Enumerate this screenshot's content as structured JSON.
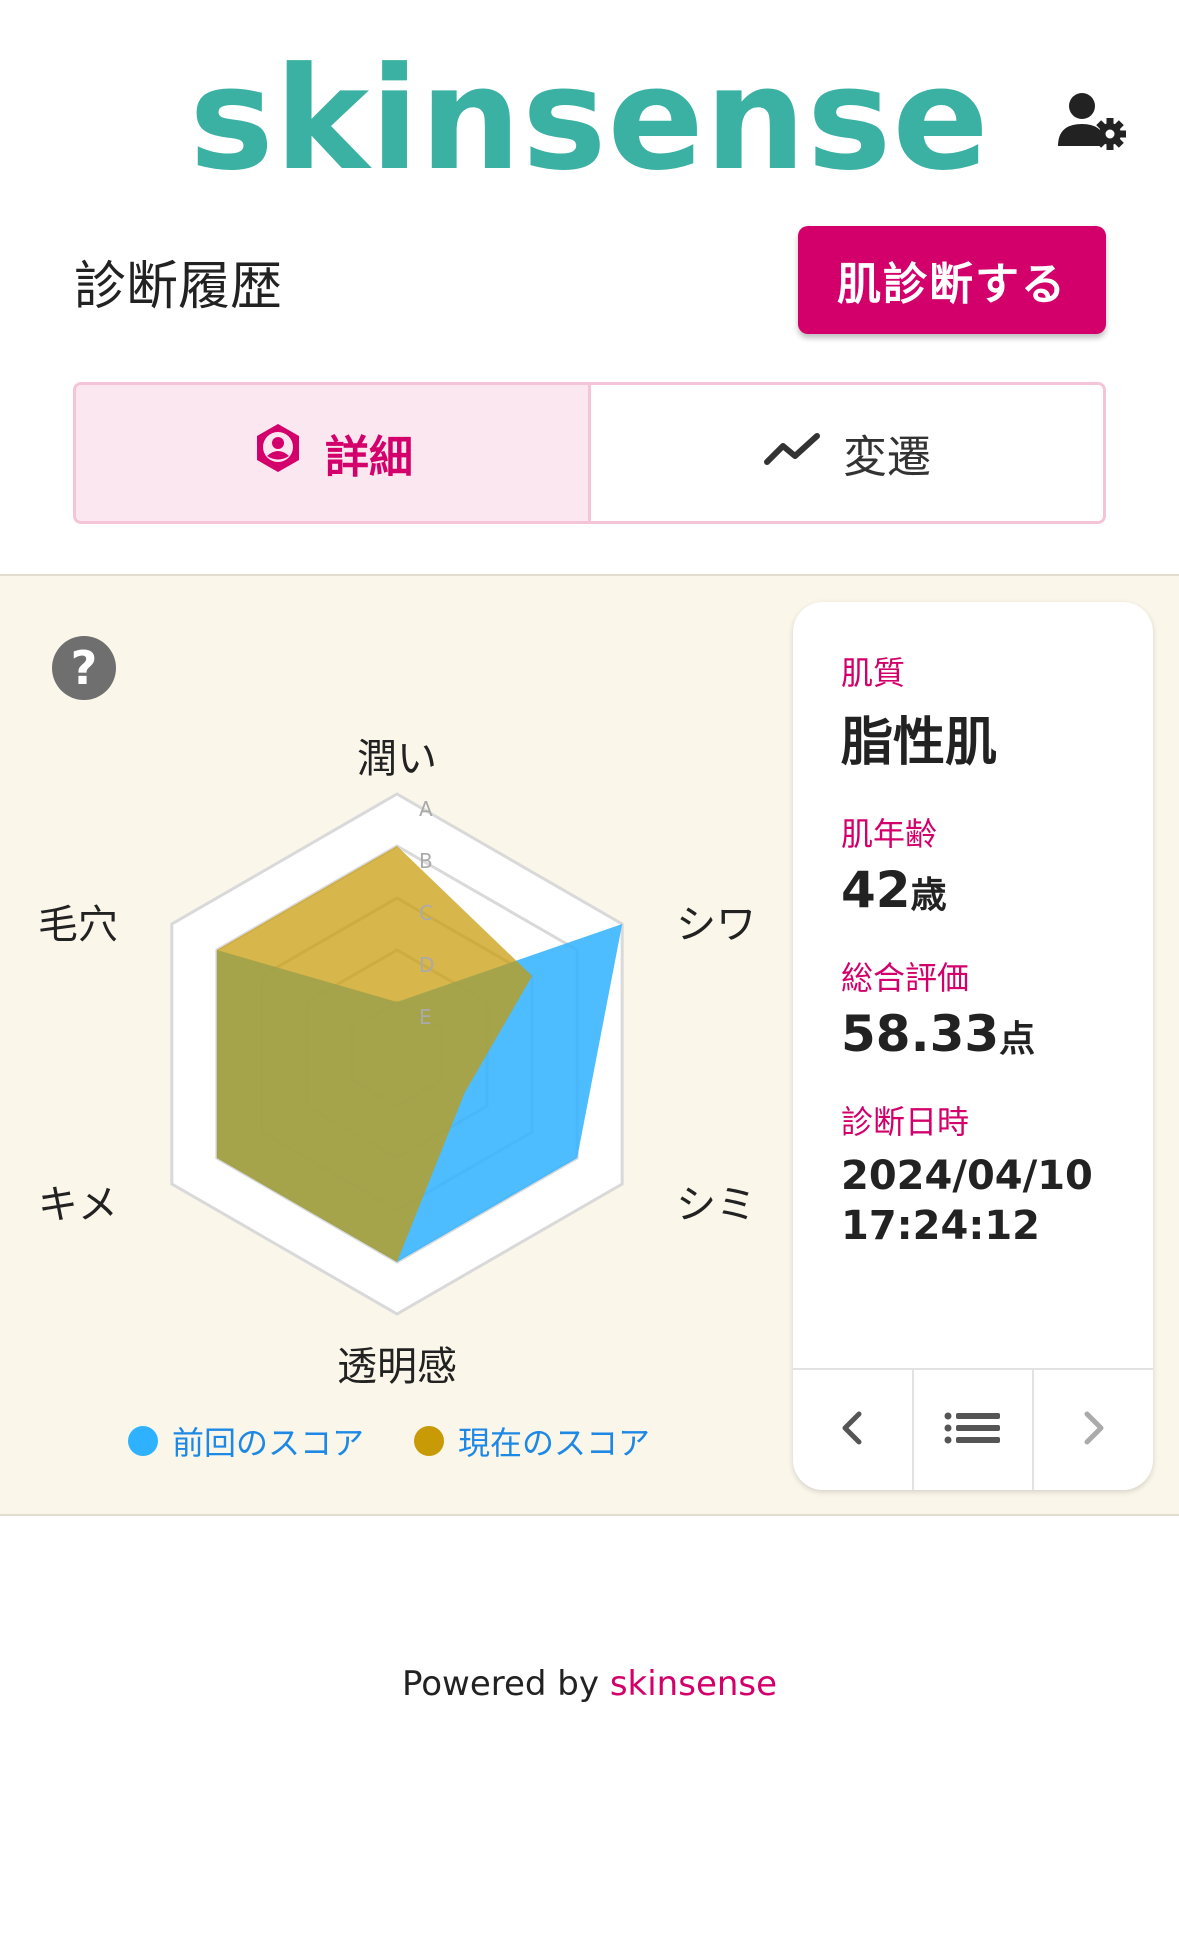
{
  "header": {
    "logo_text": "skinsense",
    "settings_icon": "user-settings-icon"
  },
  "title_row": {
    "title": "診断履歴",
    "diagnose_button": "肌診断する"
  },
  "tabs": [
    {
      "label": "詳細",
      "icon": "user-hexagon-icon",
      "active": true
    },
    {
      "label": "変遷",
      "icon": "trend-line-icon",
      "active": false
    }
  ],
  "chart_data": {
    "type": "radar",
    "axes": [
      "潤い",
      "シワ",
      "シミ",
      "透明感",
      "キメ",
      "毛穴"
    ],
    "grades": [
      "A",
      "B",
      "C",
      "D",
      "E"
    ],
    "series": [
      {
        "name": "前回のスコア",
        "color": "#2eb2ff",
        "values": [
          0.2,
          1.0,
          0.8,
          0.8,
          0.8,
          0.8
        ]
      },
      {
        "name": "現在のスコア",
        "color": "#c89a05",
        "values": [
          0.8,
          0.6,
          0.3,
          0.8,
          0.8,
          0.8
        ]
      }
    ],
    "max": 1.0
  },
  "legend": {
    "previous": "前回のスコア",
    "current": "現在のスコア"
  },
  "card": {
    "skin_type_label": "肌質",
    "skin_type_value": "脂性肌",
    "skin_age_label": "肌年齢",
    "skin_age_value": "42",
    "skin_age_unit": "歳",
    "score_label": "総合評価",
    "score_value": "58.33",
    "score_unit": "点",
    "date_label": "診断日時",
    "date_value": "2024/04/10",
    "time_value": "17:24:12"
  },
  "footer": {
    "powered_by": "Powered by",
    "brand": "skinsense"
  }
}
